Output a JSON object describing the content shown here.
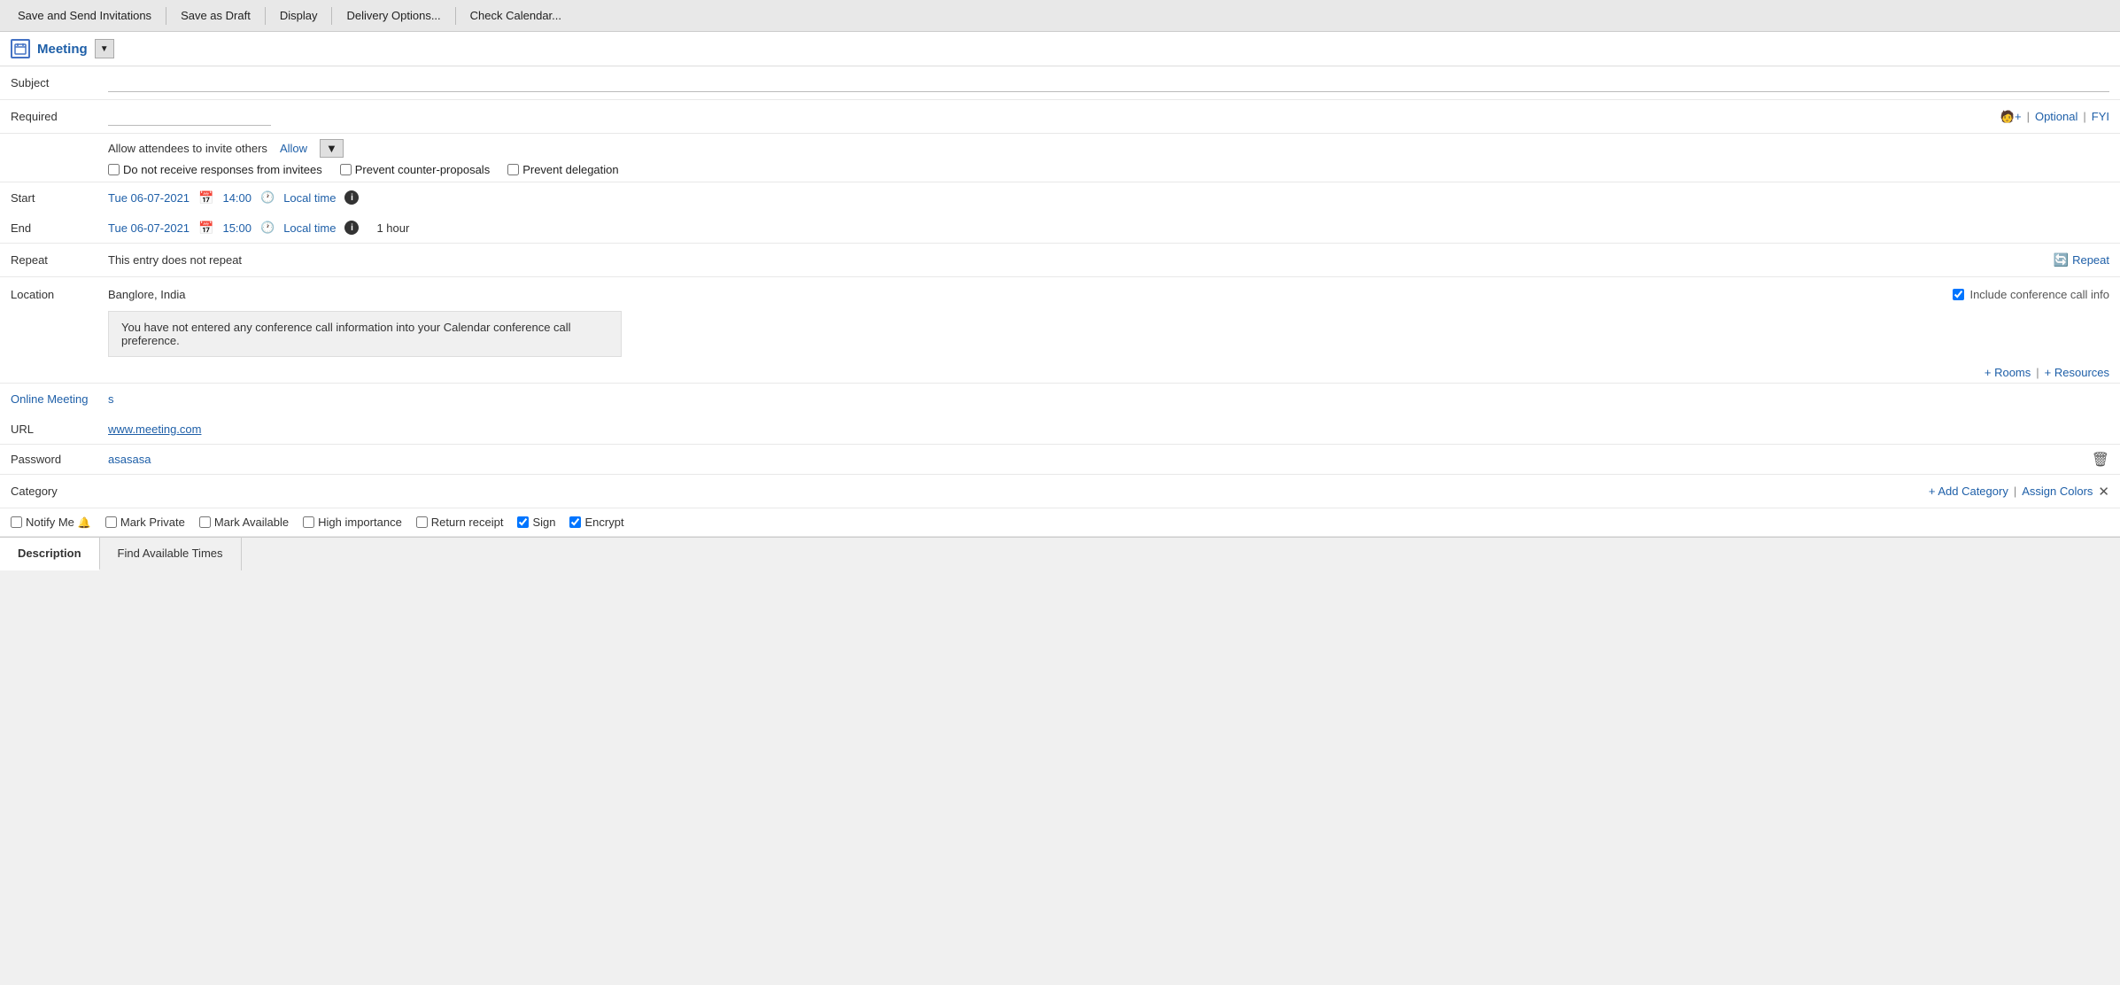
{
  "toolbar": {
    "saveAndSend": "Save and Send Invitations",
    "saveAsDraft": "Save as Draft",
    "display": "Display",
    "deliveryOptions": "Delivery Options...",
    "checkCalendar": "Check Calendar..."
  },
  "meetingHeader": {
    "title": "Meeting",
    "dropdownArrow": "▼",
    "iconLabel": "calendar-icon"
  },
  "subject": {
    "label": "Subject",
    "value": ""
  },
  "required": {
    "label": "Required",
    "actions": {
      "addPerson": "🧑+",
      "optional": "Optional",
      "fyi": "FYI",
      "separator": "|"
    }
  },
  "attendeeOptions": {
    "allowLabel": "Allow attendees to invite others",
    "allowLink": "Allow",
    "doNotReceive": "Do not receive responses from invitees",
    "preventCounter": "Prevent counter-proposals",
    "preventDelegation": "Prevent delegation"
  },
  "start": {
    "label": "Start",
    "date": "Tue 06-07-2021",
    "time": "14:00",
    "timezone": "Local time"
  },
  "end": {
    "label": "End",
    "date": "Tue 06-07-2021",
    "time": "15:00",
    "timezone": "Local time",
    "duration": "1 hour"
  },
  "repeat": {
    "label": "Repeat",
    "value": "This entry does not repeat",
    "repeatLink": "Repeat"
  },
  "location": {
    "label": "Location",
    "value": "Banglore, India",
    "conferenceCheck": "Include conference call info",
    "conferenceMessage": "You have not entered any conference call information into your Calendar conference call preference.",
    "roomsLink": "+ Rooms",
    "resourcesLink": "+ Resources"
  },
  "onlineMeeting": {
    "label": "Online Meeting",
    "sValue": "s"
  },
  "url": {
    "label": "URL",
    "value": "www.meeting.com"
  },
  "password": {
    "label": "Password",
    "value": "asasasa"
  },
  "category": {
    "label": "Category",
    "addCategoryLink": "+ Add Category",
    "assignColorsLink": "Assign Colors",
    "closeX": "✕"
  },
  "bottomCheckboxes": {
    "notifyMe": "Notify Me",
    "markPrivate": "Mark Private",
    "markAvailable": "Mark Available",
    "highImportance": "High importance",
    "returnReceipt": "Return receipt",
    "sign": "Sign",
    "encrypt": "Encrypt"
  },
  "bottomTabs": {
    "description": "Description",
    "findAvailableTimes": "Find Available Times"
  }
}
